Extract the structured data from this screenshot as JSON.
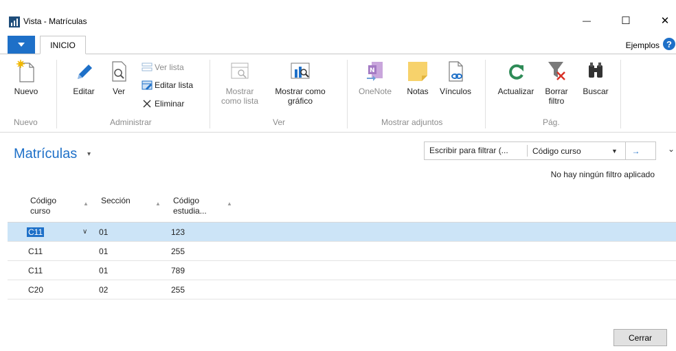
{
  "window": {
    "title": "Vista - Matrículas",
    "minimize": "—",
    "maximize": "☐",
    "close": "✕"
  },
  "tabs": {
    "file_menu_icon": "triangle-down-icon",
    "active": "INICIO",
    "ejemplos": "Ejemplos",
    "help": "?"
  },
  "ribbon": {
    "nuevo": "Nuevo",
    "editar": "Editar",
    "ver": "Ver",
    "ver_lista": "Ver lista",
    "editar_lista": "Editar lista",
    "eliminar": "Eliminar",
    "mostrar_lista_1": "Mostrar",
    "mostrar_lista_2": "como lista",
    "mostrar_grafico_1": "Mostrar como",
    "mostrar_grafico_2": "gráfico",
    "onenote": "OneNote",
    "notas": "Notas",
    "vinculos": "Vínculos",
    "actualizar": "Actualizar",
    "borrar_filtro_1": "Borrar",
    "borrar_filtro_2": "filtro",
    "buscar": "Buscar",
    "groups": {
      "nuevo": "Nuevo",
      "administrar": "Administrar",
      "ver": "Ver",
      "mostrar_adjuntos": "Mostrar adjuntos",
      "pag": "Pág."
    }
  },
  "page": {
    "title": "Matrículas",
    "title_arrow": "▾",
    "filter_placeholder": "Escribir para filtrar (...",
    "filter_field": "Código curso",
    "filter_dd": "▼",
    "filter_go": "→",
    "collapse": "⌄",
    "no_filter": "No hay ningún filtro aplicado"
  },
  "table": {
    "headers": {
      "c1_l1": "Código",
      "c1_l2": "curso",
      "c2": "Sección",
      "c3_l1": "Código",
      "c3_l2": "estudia..."
    },
    "sort_icon": "▲",
    "row_dd": "∨",
    "rows": [
      {
        "curso": "C11",
        "seccion": "01",
        "estudiante": "123"
      },
      {
        "curso": "C11",
        "seccion": "01",
        "estudiante": "255"
      },
      {
        "curso": "C11",
        "seccion": "01",
        "estudiante": "789"
      },
      {
        "curso": "C20",
        "seccion": "02",
        "estudiante": "255"
      }
    ]
  },
  "footer": {
    "close_button": "Cerrar"
  },
  "colors": {
    "accent": "#1e70c8",
    "selected_row": "#cce4f7"
  }
}
